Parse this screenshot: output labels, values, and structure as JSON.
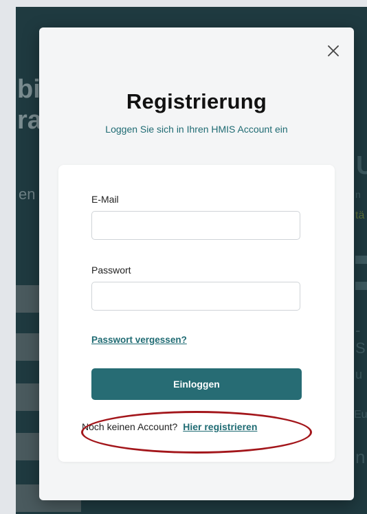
{
  "background": {
    "left_heading_fragments": [
      "bi",
      "ra"
    ],
    "left_subtext_fragment": "en",
    "right_fragments": [
      "U",
      "n",
      "tä",
      "-S",
      "u",
      "Eu",
      "n"
    ]
  },
  "modal": {
    "close_icon": "close-icon",
    "title": "Registrierung",
    "subtitle": "Loggen Sie sich in Ihren HMIS Account ein",
    "form": {
      "email_label": "E-Mail",
      "email_value": "",
      "password_label": "Passwort",
      "password_value": "",
      "forgot_link": "Passwort vergessen?",
      "login_button": "Einloggen",
      "register_prompt": "Noch keinen Account?",
      "register_link": "Hier registrieren"
    }
  },
  "annotation": {
    "color": "#a3161b",
    "target": "register-row"
  },
  "colors": {
    "accent": "#276c74",
    "link": "#1f6b73",
    "background_page": "#1f3a40"
  }
}
